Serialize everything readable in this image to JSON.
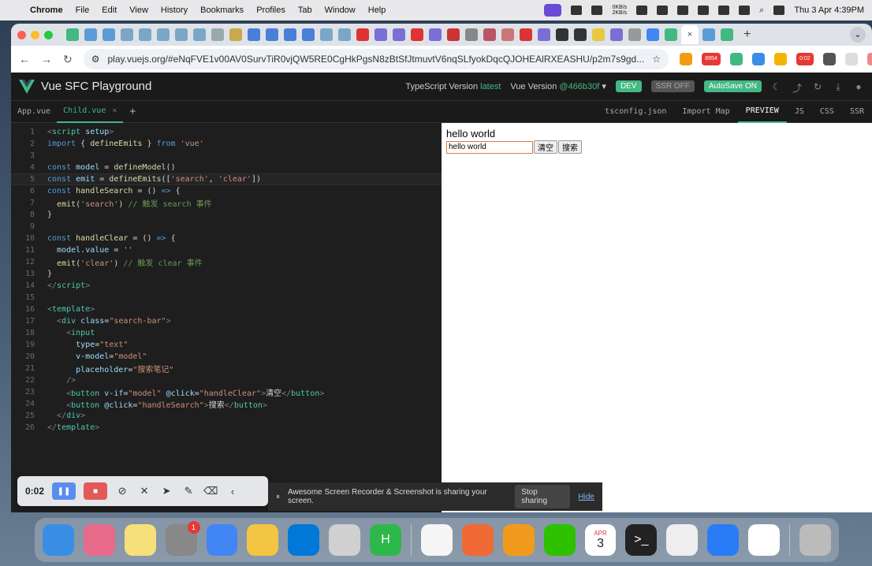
{
  "menubar": {
    "app": "Chrome",
    "items": [
      "File",
      "Edit",
      "View",
      "History",
      "Bookmarks",
      "Profiles",
      "Tab",
      "Window",
      "Help"
    ],
    "net_up": "0KB/s",
    "net_down": "2KB/s",
    "clock": "Thu 3 Apr  4:39PM"
  },
  "browser": {
    "url": "play.vuejs.org/#eNqFVE1v00AV0SurvTiR0vjQW5RE0CgHkPgsN8zBtSfJtmuvtV6nqSLfyokDqcQJOHEAlRXEASHU/p2m7s9gd...",
    "badge_text": "8954",
    "timer_ext": "0:02"
  },
  "vue": {
    "title": "Vue SFC Playground",
    "ts_label": "TypeScript Version",
    "ts_value": "latest",
    "vue_label": "Vue Version",
    "vue_value": "@466b30f",
    "dev_label": "DEV",
    "ssr_label": "SSR OFF",
    "autosave_label": "AutoSave ON",
    "file_tabs": [
      "App.vue",
      "Child.vue"
    ],
    "right_tabs": [
      "tsconfig.json",
      "Import Map",
      "PREVIEW",
      "JS",
      "CSS",
      "SSR"
    ],
    "plus": "+",
    "close": "×"
  },
  "preview": {
    "heading": "hello world",
    "input_value": "hello world",
    "clear_label": "清空",
    "search_label": "搜索"
  },
  "recorder": {
    "time": "0:02",
    "share_text": "Awesome Screen Recorder & Screenshot is sharing your screen.",
    "stop_label": "Stop sharing",
    "hide_label": "Hide"
  },
  "dock": {
    "settings_badge": "1",
    "calendar_month": "APR",
    "calendar_day": "3"
  }
}
